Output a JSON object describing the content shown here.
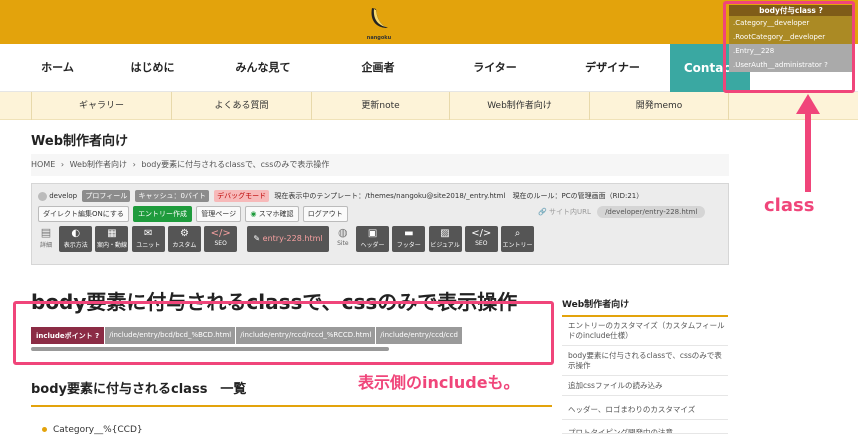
{
  "header": {
    "logo_text": "nangoku",
    "brand_color": "#e3a30c"
  },
  "main_nav": {
    "items": [
      "ホーム",
      "はじめに",
      "みんな見て",
      "企画者",
      "ライター",
      "デザイナー"
    ],
    "contact": "Contact"
  },
  "sub_nav": {
    "items": [
      "ギャラリー",
      "よくある質問",
      "更新note",
      "Web制作者向け",
      "開発memo"
    ]
  },
  "page_title": "Web制作者向け",
  "breadcrumb": {
    "home": "HOME",
    "sep": "›",
    "category": "Web制作者向け",
    "current": "body要素に付与されるclassで、cssのみで表示操作"
  },
  "admin": {
    "user": "develop",
    "profile_tag": "プロフィール",
    "cache_tag": "キャッシュ：0バイト",
    "debug_tag": "デバッグモード",
    "template_text": "現在表示中のテンプレート：/themes/nangoku@site2018/_entry.html",
    "rule_text": "現在のルール：PCの管理画面（RID:21）",
    "buttons": [
      "ダイレクト編集ONにする",
      "エントリー作成",
      "管理ページ",
      "スマホ確認",
      "ログアウト"
    ],
    "site_url_label": "サイト内URL",
    "site_url_value": "/developer/entry-228.html",
    "detail_label": "詳細",
    "icon_buttons_1": [
      "表示方法",
      "案内・動線",
      "ユニット",
      "カスタム",
      "SEO"
    ],
    "file_button": "entry-228.html",
    "site_label": "Site",
    "icon_buttons_2": [
      "ヘッダー",
      "フッター",
      "ビジュアル",
      "SEO",
      "エントリー"
    ]
  },
  "article": {
    "title": "body要素に付与されるclassで、cssのみで表示操作",
    "include_label": "includeポイント",
    "include_paths": [
      "/include/entry/bcd/bcd_%BCD.html",
      "/include/entry/rccd/rccd_%RCCD.html",
      "/include/entry/ccd/ccd"
    ],
    "section_title": "body要素に付与されるclass　一覧",
    "list_item": "Category__%{CCD}"
  },
  "sidebar": {
    "heading": "Web制作者向け",
    "items": [
      "エントリーのカスタマイズ（カスタムフィールドのinclude仕様）",
      "body要素に付与されるclassで、cssのみで表示操作",
      "追加cssファイルの読み込み",
      "ヘッダー、ロゴまわりのカスタマイズ",
      "プロトタイピング開発中の注意"
    ]
  },
  "overlay": {
    "title": "body付与class",
    "rows": [
      ".Category__developer",
      ".RootCategory__developer",
      ".Entry__228",
      ".UserAuth__administrator"
    ]
  },
  "annotations": {
    "class_label": "class",
    "include_label": "表示側のincludeも。",
    "color": "#f0457a"
  }
}
